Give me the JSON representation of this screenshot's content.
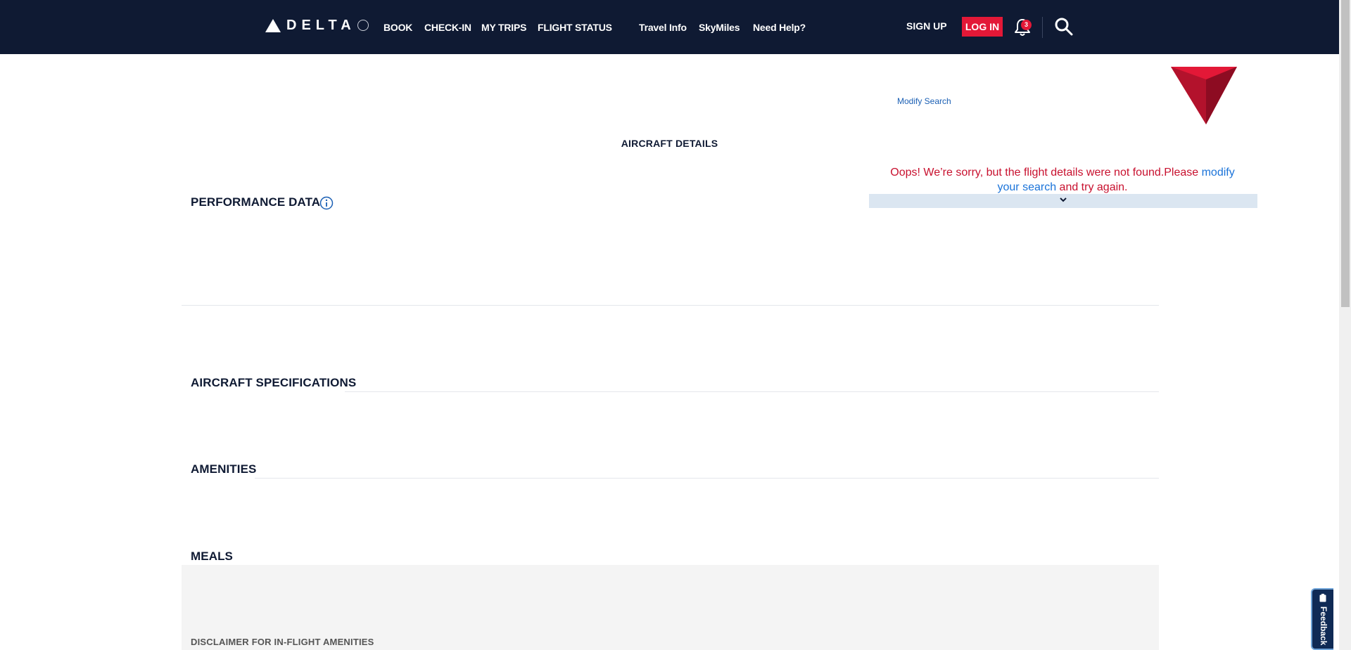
{
  "header": {
    "logo_text": "DELTA",
    "nav_main": [
      "BOOK",
      "CHECK-IN",
      "MY TRIPS",
      "FLIGHT STATUS"
    ],
    "nav_sub": [
      "Travel Info",
      "SkyMiles",
      "Need Help?"
    ],
    "signup_label": "SIGN UP",
    "login_label": "LOG IN",
    "notification_count": "3",
    "icons": [
      "delta-logo-icon",
      "globe-icon",
      "bell-icon",
      "search-icon"
    ]
  },
  "main": {
    "modify_search_label": "Modify Search",
    "page_title": "AIRCRAFT DETAILS",
    "error": {
      "prefix": "Oops! We’re sorry, but the flight details were not found.Please ",
      "link": "modify your search",
      "suffix": " and try again."
    },
    "sections": {
      "performance": "PERFORMANCE DATA",
      "specifications": "AIRCRAFT SPECIFICATIONS",
      "amenities": "AMENITIES",
      "meals": "MEALS"
    },
    "disclaimer": "DISCLAIMER FOR IN-FLIGHT AMENITIES"
  },
  "feedback": {
    "label": "Feedback"
  },
  "colors": {
    "header_bg": "#0f1a33",
    "brand_red": "#e31837",
    "error_red": "#c8102e",
    "link_blue": "#1a73d9",
    "title_navy": "#0f1a33",
    "collapse_bar": "#dbe6f1"
  }
}
